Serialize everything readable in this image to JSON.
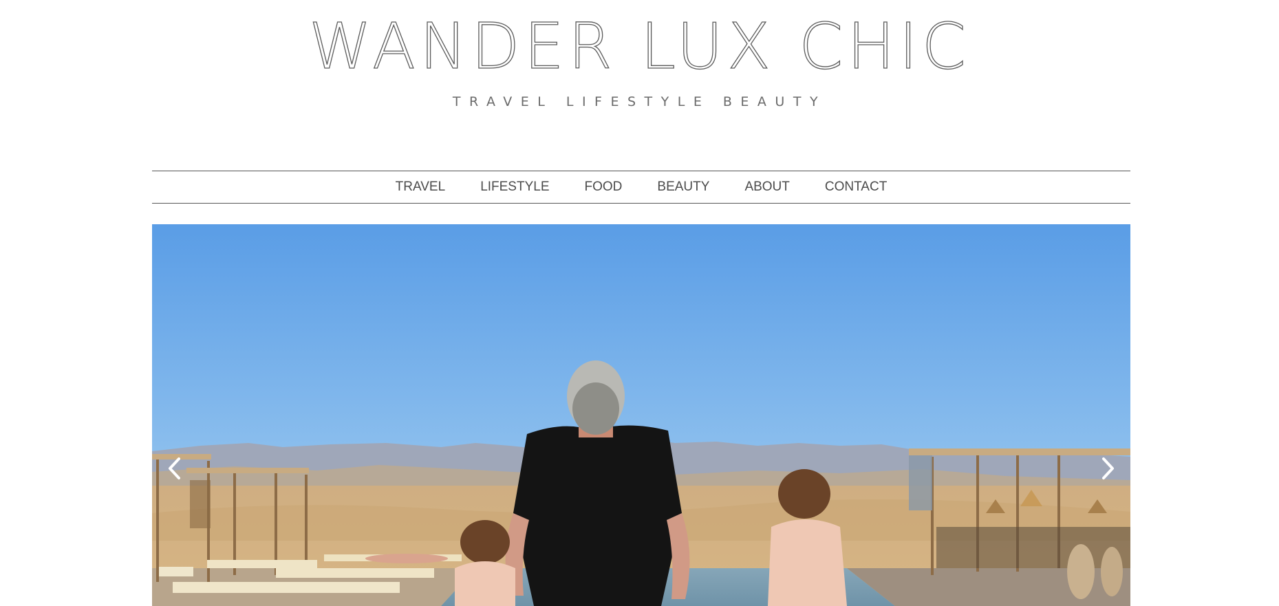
{
  "site": {
    "title": "WANDER LUX CHIC",
    "tagline": "TRAVEL LIFESTYLE BEAUTY"
  },
  "nav": {
    "items": [
      {
        "label": "TRAVEL"
      },
      {
        "label": "LIFESTYLE"
      },
      {
        "label": "FOOD"
      },
      {
        "label": "BEAUTY"
      },
      {
        "label": "ABOUT"
      },
      {
        "label": "CONTACT"
      }
    ]
  },
  "slider": {
    "prev_icon": "chevron-left-icon",
    "next_icon": "chevron-right-icon"
  },
  "colors": {
    "text": "#4a4a4a",
    "rule": "#555555",
    "sky_top": "#5b9ee6",
    "sky_bottom": "#93c3ee",
    "desert": "#d2b07e"
  }
}
